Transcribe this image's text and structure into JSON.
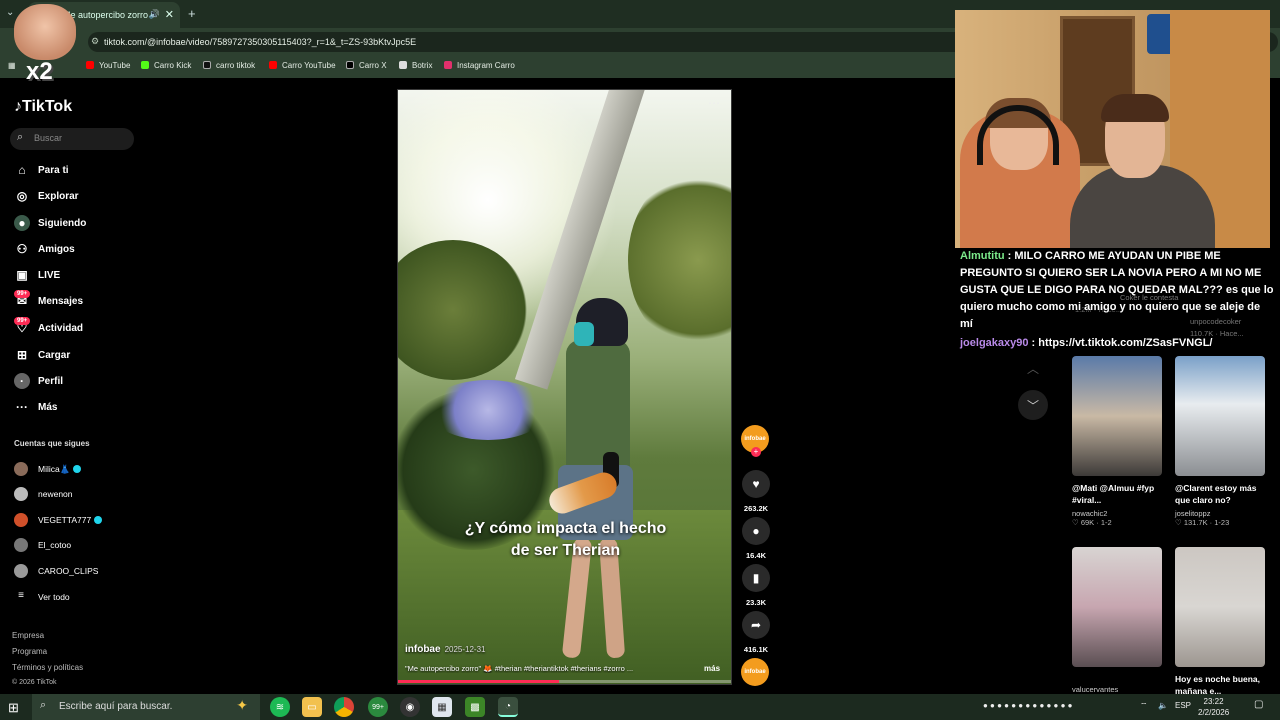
{
  "browser": {
    "tab_title": ")Me autopercibo zorro",
    "url": "tiktok.com/@infobae/video/7589727350305115403?_r=1&_t=ZS-93bKtvJpc5E",
    "bookmarks": [
      {
        "label": "YouTube",
        "color": "#ff0000"
      },
      {
        "label": "Carro Kick",
        "color": "#53fc18"
      },
      {
        "label": "carro tiktok",
        "color": "#111111"
      },
      {
        "label": "Carro YouTube",
        "color": "#ff0000"
      },
      {
        "label": "Carro X",
        "color": "#000000"
      },
      {
        "label": "Botrix",
        "color": "#dddddd"
      },
      {
        "label": "Instagram Carro",
        "color": "#e1306c"
      }
    ]
  },
  "overlay": {
    "multiplier": "x2"
  },
  "tiktok": {
    "logo": "TikTok",
    "search_placeholder": "Buscar",
    "nav": [
      {
        "label": "Para ti",
        "icon": "home-icon"
      },
      {
        "label": "Explorar",
        "icon": "compass-icon"
      },
      {
        "label": "Siguiendo",
        "icon": "following-icon"
      },
      {
        "label": "Amigos",
        "icon": "friends-icon"
      },
      {
        "label": "LIVE",
        "icon": "live-icon"
      },
      {
        "label": "Mensajes",
        "icon": "messages-icon",
        "badge": "99+"
      },
      {
        "label": "Actividad",
        "icon": "activity-icon",
        "badge": "99+"
      },
      {
        "label": "Cargar",
        "icon": "upload-icon"
      },
      {
        "label": "Perfil",
        "icon": "profile-icon"
      },
      {
        "label": "Más",
        "icon": "more-icon"
      }
    ],
    "following_title": "Cuentas que sigues",
    "following": [
      {
        "name": "Milica👗",
        "verified": true,
        "color": "#8a6b5a"
      },
      {
        "name": "newenon",
        "verified": false,
        "color": "#bbbbbb"
      },
      {
        "name": "VEGETTA777",
        "verified": true,
        "color": "#d0502a"
      },
      {
        "name": "El_cotoo",
        "verified": false,
        "color": "#777777"
      },
      {
        "name": "CAROO_CLIPS",
        "verified": false,
        "color": "#999999"
      }
    ],
    "see_all": "Ver todo",
    "footer": [
      "Empresa",
      "Programa",
      "Términos y políticas",
      "© 2026 TikTok"
    ]
  },
  "video": {
    "caption_line1": "¿Y cómo impacta el hecho",
    "caption_line2": "de ser Therian",
    "author": "infobae",
    "date": "2025-12-31",
    "description": "\"Me autopercibo zorro\" 🦊 #therian #theriantiktok #therians #zorro ...",
    "more": "más",
    "progress": 0.48,
    "author_avatar_text": "infobae",
    "likes": "263.2K",
    "comments": "16.4K",
    "saves": "23.3K",
    "shares": "416.1K"
  },
  "chat": [
    {
      "user": "Almutitu",
      "message": "MILO CARRO ME AYUDAN UN PIBE ME PREGUNTO SI QUIERO SER LA NOVIA PERO A MI NO ME GUSTA QUE LE DIGO PARA NO QUEDAR MAL??? es que lo quiero mucho como mi amigo y no quiero que se aleje de mí"
    },
    {
      "user": "joelgakaxy90",
      "message": "https://vt.tiktok.com/ZSasFVNGL/"
    }
  ],
  "ghost_recs": {
    "likes": "1.2M · Hace...",
    "title2": "Coker le contesta",
    "user2": "unpocodecoker",
    "likes2": "110.7K · Hace..."
  },
  "recommendations": [
    {
      "title": "@Mati @Almuu #fyp #viral...",
      "user": "nowachic2",
      "stats": "69K · 1-2"
    },
    {
      "title": "@Clarent estoy más que claro no?",
      "user": "joselitoppz",
      "stats": "131.7K · 1-23"
    },
    {
      "title": "",
      "user": "valucervantes",
      "stats": ""
    },
    {
      "title": "Hoy es noche buena, mañana e...",
      "user": "",
      "stats": ""
    }
  ],
  "taskbar": {
    "search_placeholder": "Escribe aquí para buscar.",
    "lang": "ESP",
    "time": "23:22",
    "date": "2/2/2026"
  }
}
